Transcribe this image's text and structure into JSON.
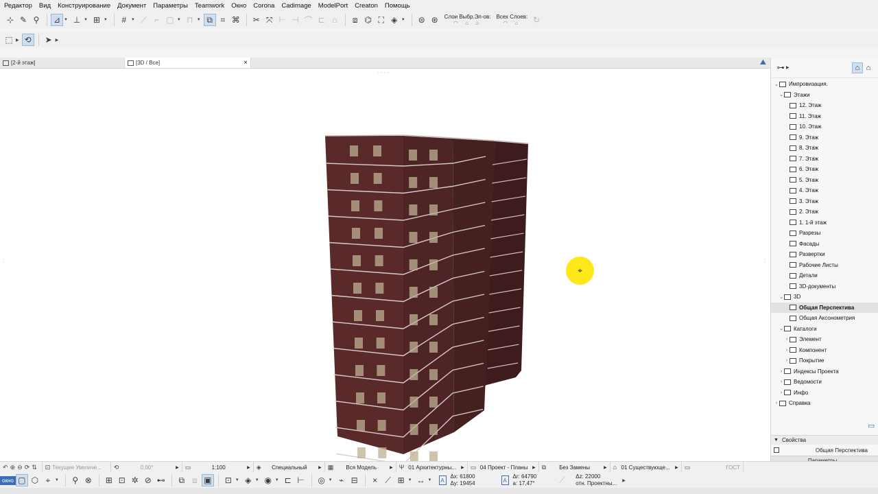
{
  "menu": [
    "Редактор",
    "Вид",
    "Конструирование",
    "Документ",
    "Параметры",
    "Teamwork",
    "Окно",
    "Corona",
    "Cadimage",
    "ModelPort",
    "Creaton",
    "Помощь"
  ],
  "toolbar1": {
    "layers_label": "Слои Выбр.Эл-ов:",
    "all_layers_label": "Всех Слоев:"
  },
  "tabs": [
    {
      "label": "[2-й этаж]"
    },
    {
      "label": "[3D / Все]"
    }
  ],
  "tab_close": "×",
  "navigator": {
    "root": "Импровизация.",
    "floors_group": "Этажи",
    "floors": [
      "12. Этаж",
      "11. Этаж",
      "10. Этаж",
      "9. Этаж",
      "8. Этаж",
      "7. Этаж",
      "6. Этаж",
      "5. Этаж",
      "4. Этаж",
      "3. Этаж",
      "2. Этаж",
      "1. 1-й этаж"
    ],
    "sections": "Разрезы",
    "elevations": "Фасады",
    "interior_elevations": "Развертки",
    "worksheets": "Рабочие Листы",
    "details": "Детали",
    "documents_3d": "3D-документы",
    "group_3d": "3D",
    "perspective": "Общая Перспектива",
    "axonometry": "Общая Аксонометрия",
    "catalogs": "Каталоги",
    "catalog_items": [
      "Элемент",
      "Компонент",
      "Покрытие"
    ],
    "project_indexes": "Индексы Проекта",
    "schedules": "Ведомости",
    "info": "Инфо",
    "help": "Справка"
  },
  "properties": {
    "header": "Свойства",
    "value": "Общая Перспектива",
    "button": "Параметры..."
  },
  "statusbar": {
    "zoom": "Текущее Увеличе...",
    "angle": "0,00°",
    "scale": "1:100",
    "structure": "Специальный",
    "model": "Вся Модель",
    "architecture": "01 Архитектурны...",
    "plans": "04 Проект - Планы",
    "override": "Без Замены",
    "existing": "01 Существующе...",
    "standard": "ГОСТ"
  },
  "coords": {
    "dx": "Δx: 61800",
    "dy": "Δy: 19454",
    "dr": "Δr: 64790",
    "da": "a: 17,47°",
    "dz": "Δz: 22000",
    "ref": "отн. Проектны..."
  },
  "bottom_left": "окно",
  "colors": {
    "facade": "#5a2a2b",
    "facade_shadow": "#3e1c1e",
    "window": "#bfb093",
    "cursor_highlight": "#ffe81a",
    "accent": "#3a6fb6"
  }
}
